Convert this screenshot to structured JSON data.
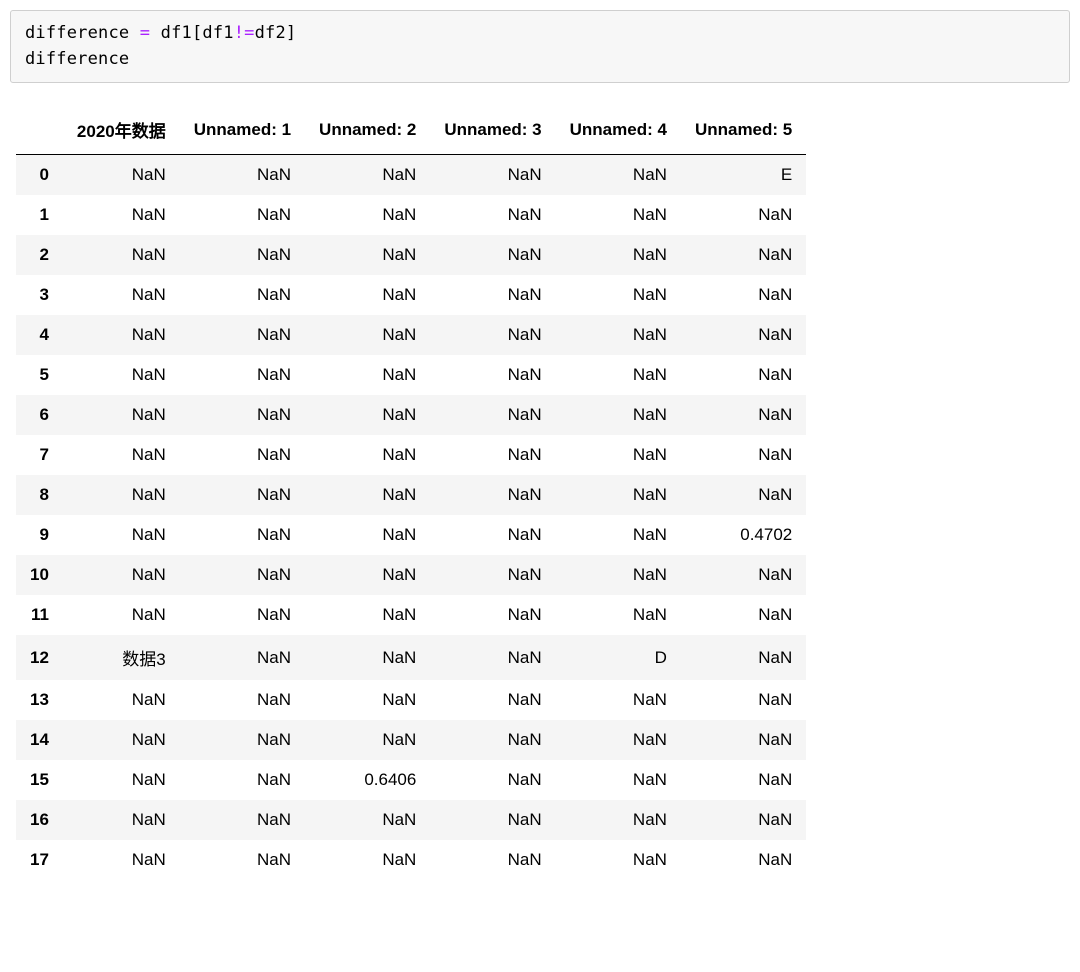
{
  "code": {
    "line1": {
      "lhs": "difference",
      "eq": " = ",
      "rhs_a": "df1",
      "br_open": "[",
      "cmp_a": "df1",
      "neq": "!=",
      "cmp_b": "df2",
      "br_close": "]"
    },
    "line2": "difference"
  },
  "df": {
    "columns": [
      "2020年数据",
      "Unnamed: 1",
      "Unnamed: 2",
      "Unnamed: 3",
      "Unnamed: 4",
      "Unnamed: 5"
    ],
    "index": [
      "0",
      "1",
      "2",
      "3",
      "4",
      "5",
      "6",
      "7",
      "8",
      "9",
      "10",
      "11",
      "12",
      "13",
      "14",
      "15",
      "16",
      "17"
    ],
    "rows": [
      [
        "NaN",
        "NaN",
        "NaN",
        "NaN",
        "NaN",
        "E"
      ],
      [
        "NaN",
        "NaN",
        "NaN",
        "NaN",
        "NaN",
        "NaN"
      ],
      [
        "NaN",
        "NaN",
        "NaN",
        "NaN",
        "NaN",
        "NaN"
      ],
      [
        "NaN",
        "NaN",
        "NaN",
        "NaN",
        "NaN",
        "NaN"
      ],
      [
        "NaN",
        "NaN",
        "NaN",
        "NaN",
        "NaN",
        "NaN"
      ],
      [
        "NaN",
        "NaN",
        "NaN",
        "NaN",
        "NaN",
        "NaN"
      ],
      [
        "NaN",
        "NaN",
        "NaN",
        "NaN",
        "NaN",
        "NaN"
      ],
      [
        "NaN",
        "NaN",
        "NaN",
        "NaN",
        "NaN",
        "NaN"
      ],
      [
        "NaN",
        "NaN",
        "NaN",
        "NaN",
        "NaN",
        "NaN"
      ],
      [
        "NaN",
        "NaN",
        "NaN",
        "NaN",
        "NaN",
        "0.4702"
      ],
      [
        "NaN",
        "NaN",
        "NaN",
        "NaN",
        "NaN",
        "NaN"
      ],
      [
        "NaN",
        "NaN",
        "NaN",
        "NaN",
        "NaN",
        "NaN"
      ],
      [
        "数据3",
        "NaN",
        "NaN",
        "NaN",
        "D",
        "NaN"
      ],
      [
        "NaN",
        "NaN",
        "NaN",
        "NaN",
        "NaN",
        "NaN"
      ],
      [
        "NaN",
        "NaN",
        "NaN",
        "NaN",
        "NaN",
        "NaN"
      ],
      [
        "NaN",
        "NaN",
        "0.6406",
        "NaN",
        "NaN",
        "NaN"
      ],
      [
        "NaN",
        "NaN",
        "NaN",
        "NaN",
        "NaN",
        "NaN"
      ],
      [
        "NaN",
        "NaN",
        "NaN",
        "NaN",
        "NaN",
        "NaN"
      ]
    ]
  }
}
